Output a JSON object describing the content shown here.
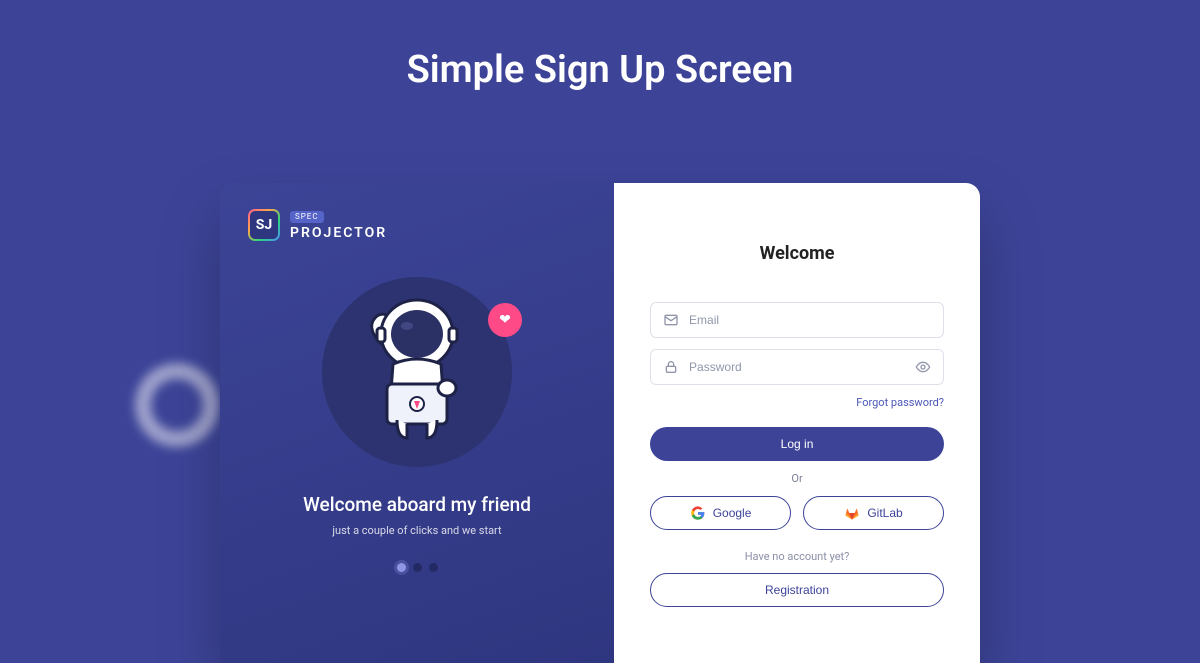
{
  "page": {
    "title": "Simple Sign Up Screen"
  },
  "brand": {
    "mark": "SJ",
    "small": "SPEC",
    "main": "PROJECTOR"
  },
  "hero": {
    "title": "Welcome aboard my friend",
    "subtitle": "just a couple of clicks and we start"
  },
  "form": {
    "title": "Welcome",
    "email_placeholder": "Email",
    "password_placeholder": "Password",
    "forgot": "Forgot password?",
    "login": "Log in",
    "or": "Or",
    "google": "Google",
    "gitlab": "GitLab",
    "noacct": "Have no account yet?",
    "register": "Registration"
  }
}
